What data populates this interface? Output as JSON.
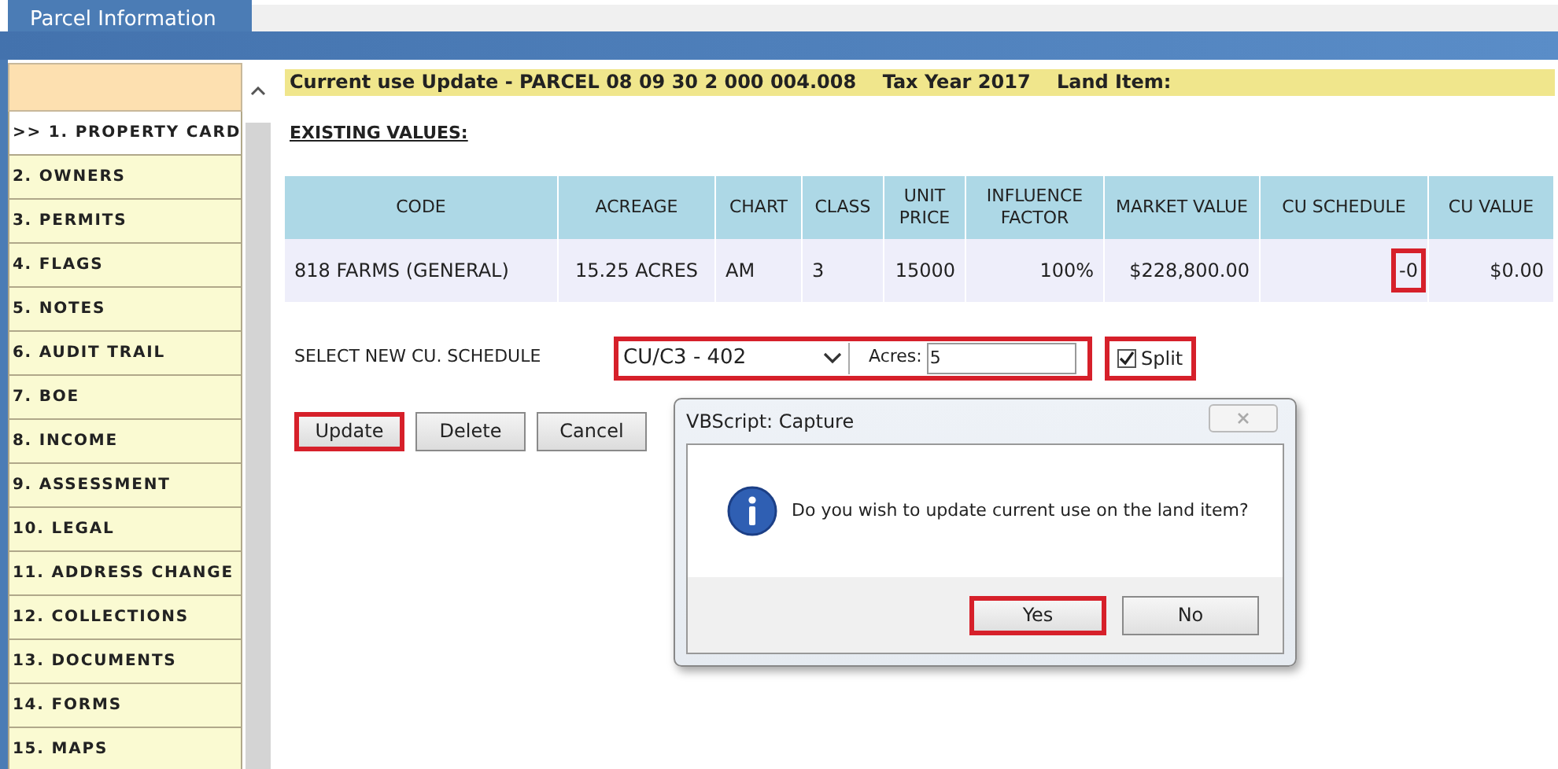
{
  "tab": {
    "label": "Parcel Information",
    "selected": true
  },
  "sidebar": {
    "items": [
      {
        "label": ">> 1. PROPERTY CARD",
        "selected": true
      },
      {
        "label": "2. OWNERS",
        "selected": false
      },
      {
        "label": "3. PERMITS",
        "selected": false
      },
      {
        "label": "4. FLAGS",
        "selected": false
      },
      {
        "label": "5. NOTES",
        "selected": false
      },
      {
        "label": "6. AUDIT TRAIL",
        "selected": false
      },
      {
        "label": "7. BOE",
        "selected": false
      },
      {
        "label": "8. INCOME",
        "selected": false
      },
      {
        "label": "9. ASSESSMENT",
        "selected": false
      },
      {
        "label": "10. LEGAL",
        "selected": false
      },
      {
        "label": "11. ADDRESS CHANGE",
        "selected": false
      },
      {
        "label": "12. COLLECTIONS",
        "selected": false
      },
      {
        "label": "13. DOCUMENTS",
        "selected": false
      },
      {
        "label": "14. FORMS",
        "selected": false
      },
      {
        "label": "15. MAPS",
        "selected": false
      }
    ]
  },
  "header": "Current use Update - PARCEL 08 09 30 2 000 004.008    Tax Year 2017    Land Item:",
  "section_title": "EXISTING VALUES:",
  "table": {
    "columns": [
      "CODE",
      "ACREAGE",
      "CHART",
      "CLASS",
      "UNIT PRICE",
      "INFLUENCE FACTOR",
      "MARKET VALUE",
      "CU SCHEDULE",
      "CU VALUE"
    ],
    "rows": [
      {
        "cells": [
          {
            "text": "818 FARMS (GENERAL)",
            "highlighted": false
          },
          {
            "text": "15.25 ACRES",
            "highlighted": false
          },
          {
            "text": "AM",
            "highlighted": false
          },
          {
            "text": "3",
            "highlighted": false
          },
          {
            "text": "15000",
            "highlighted": false
          },
          {
            "text": "100%",
            "highlighted": false
          },
          {
            "text": "$228,800.00",
            "highlighted": false
          },
          {
            "text": "-0",
            "highlighted": true
          },
          {
            "text": "$0.00",
            "highlighted": false
          }
        ]
      }
    ]
  },
  "schedule": {
    "label": "SELECT NEW CU. SCHEDULE",
    "value": "CU/C3 - 402",
    "acres_label": "Acres:",
    "acres_value": "5",
    "highlighted": true
  },
  "split": {
    "label": "Split",
    "checked": true,
    "highlighted": true
  },
  "buttons": [
    {
      "label": "Update",
      "highlighted": true
    },
    {
      "label": "Delete",
      "highlighted": false
    },
    {
      "label": "Cancel",
      "highlighted": false
    }
  ],
  "dialog": {
    "title": "VBScript: Capture",
    "message": "Do you wish to update current use on the land item?",
    "buttons": [
      {
        "label": "Yes",
        "highlighted": true
      },
      {
        "label": "No",
        "highlighted": false
      }
    ]
  }
}
